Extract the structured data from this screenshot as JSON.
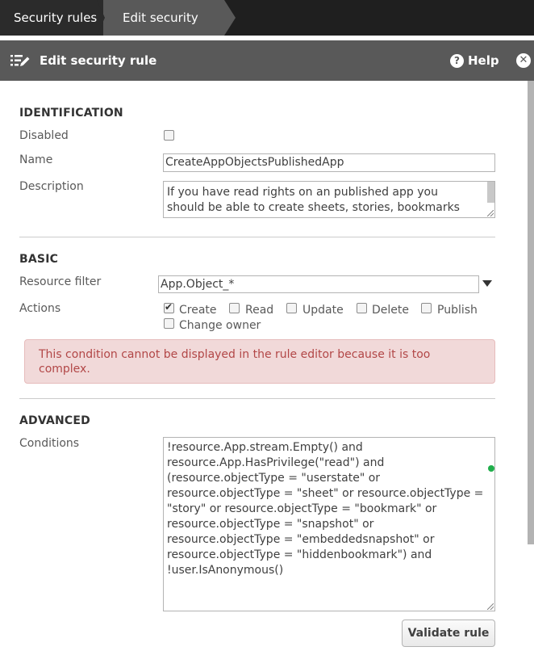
{
  "breadcrumb": {
    "items": [
      "Security rules",
      "Edit security rule"
    ]
  },
  "dialog": {
    "title": "Edit security rule",
    "help_label": "Help",
    "close_icon": "close-icon",
    "title_icon": "edit-list-icon"
  },
  "identification": {
    "heading": "IDENTIFICATION",
    "disabled_label": "Disabled",
    "disabled_checked": false,
    "name_label": "Name",
    "name_value": "CreateAppObjectsPublishedApp",
    "description_label": "Description",
    "description_value": "If you have read rights on an published app you\nshould be able to create sheets, stories, bookmarks"
  },
  "basic": {
    "heading": "BASIC",
    "resource_filter_label": "Resource filter",
    "resource_filter_value": "App.Object_*",
    "actions_label": "Actions",
    "actions": [
      {
        "label": "Create",
        "checked": true
      },
      {
        "label": "Read",
        "checked": false
      },
      {
        "label": "Update",
        "checked": false
      },
      {
        "label": "Delete",
        "checked": false
      },
      {
        "label": "Publish",
        "checked": false
      },
      {
        "label": "Change owner",
        "checked": false
      }
    ],
    "warning": "This condition cannot be displayed in the rule editor because it is too complex."
  },
  "advanced": {
    "heading": "ADVANCED",
    "conditions_label": "Conditions",
    "conditions_value": "!resource.App.stream.Empty() and\nresource.App.HasPrivilege(\"read\") and\n(resource.objectType = \"userstate\" or\nresource.objectType = \"sheet\" or resource.objectType =\n\"story\" or resource.objectType = \"bookmark\" or\nresource.objectType = \"snapshot\" or\nresource.objectType = \"embeddedsnapshot\" or\nresource.objectType = \"hiddenbookmark\") and\n!user.IsAnonymous()",
    "status_color": "#1fae4b"
  },
  "validate_label": "Validate rule"
}
